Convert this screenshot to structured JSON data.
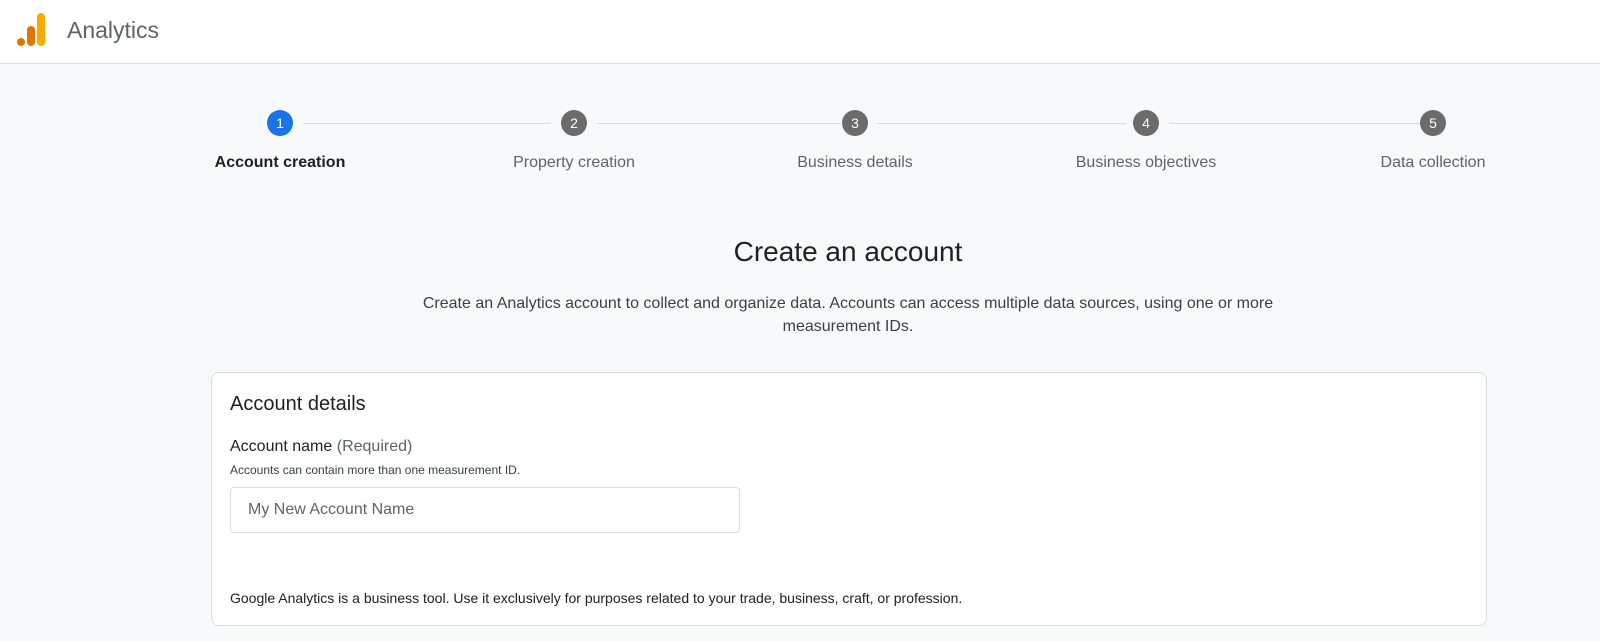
{
  "header": {
    "app_title": "Analytics",
    "logo_icon": "analytics-logo-icon"
  },
  "stepper": {
    "steps": [
      {
        "number": "1",
        "label": "Account creation",
        "active": true
      },
      {
        "number": "2",
        "label": "Property creation",
        "active": false
      },
      {
        "number": "3",
        "label": "Business details",
        "active": false
      },
      {
        "number": "4",
        "label": "Business objectives",
        "active": false
      },
      {
        "number": "5",
        "label": "Data collection",
        "active": false
      }
    ]
  },
  "main": {
    "title": "Create an account",
    "description": "Create an Analytics account to collect and organize data. Accounts can access multiple data sources, using one or more measurement IDs."
  },
  "account_details": {
    "title": "Account details",
    "account_name_label": "Account name",
    "required_text": "(Required)",
    "hint": "Accounts can contain more than one measurement ID.",
    "input_value": "",
    "input_placeholder": "My New Account Name",
    "footnote": "Google Analytics is a business tool. Use it exclusively for purposes related to your trade, business, craft, or profession."
  },
  "colors": {
    "active_step": "#1a73e8",
    "inactive_step": "#6b6b6b",
    "logo_orange": "#e37400",
    "logo_yellow": "#f9ab00"
  }
}
